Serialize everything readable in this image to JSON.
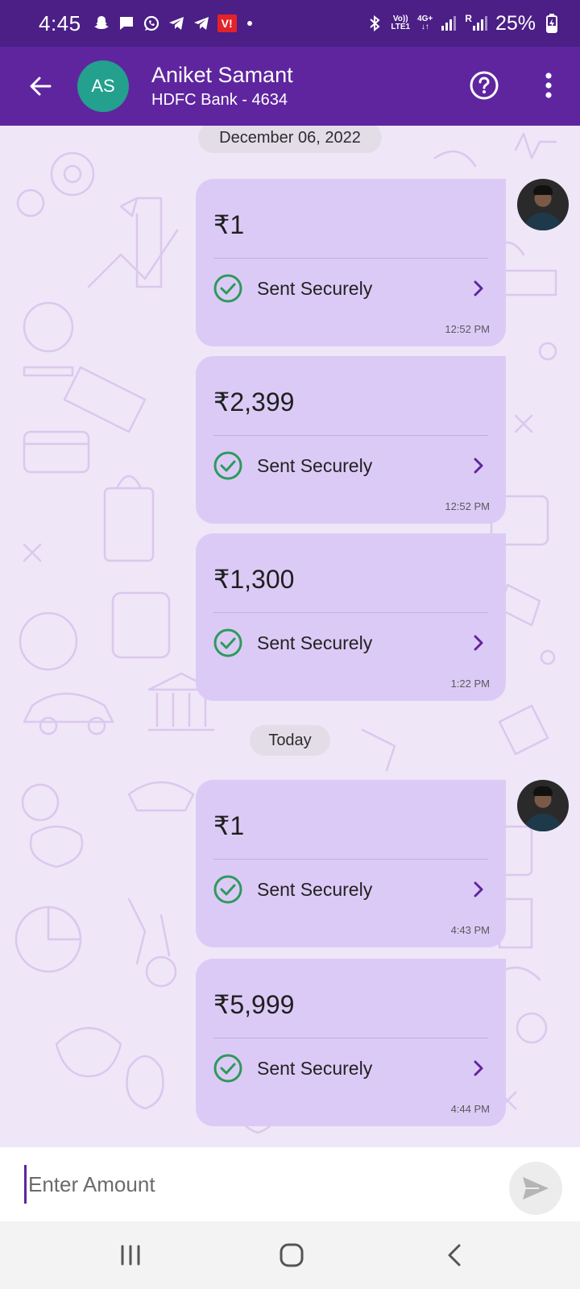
{
  "status_bar": {
    "time": "4:45",
    "carrier_badge": "V!",
    "volte_top": "Vo))",
    "volte_bottom": "LTE1",
    "network_top": "4G+",
    "network_bottom": "↓↑",
    "roaming": "R",
    "battery": "25%",
    "icons": [
      "snapchat-icon",
      "message-icon",
      "whatsapp-icon",
      "telegram-icon",
      "telegram-icon",
      "bluetooth-icon",
      "signal-icon",
      "battery-charging-icon"
    ]
  },
  "header": {
    "initials": "AS",
    "name": "Aniket Samant",
    "subtitle": "HDFC Bank - 4634",
    "background": "#5f259f"
  },
  "chat": {
    "date_labels": [
      "December 06, 2022",
      "Today"
    ],
    "messages": [
      {
        "amount": "₹1",
        "status": "Sent Securely",
        "time": "12:52 PM"
      },
      {
        "amount": "₹2,399",
        "status": "Sent Securely",
        "time": "12:52 PM"
      },
      {
        "amount": "₹1,300",
        "status": "Sent Securely",
        "time": "1:22 PM"
      },
      {
        "amount": "₹1",
        "status": "Sent Securely",
        "time": "4:43 PM"
      },
      {
        "amount": "₹5,999",
        "status": "Sent Securely",
        "time": "4:44 PM"
      }
    ],
    "bubble_color": "#dccaf6",
    "success_color": "#2d9a5c"
  },
  "input": {
    "placeholder": "Enter Amount",
    "value": ""
  }
}
